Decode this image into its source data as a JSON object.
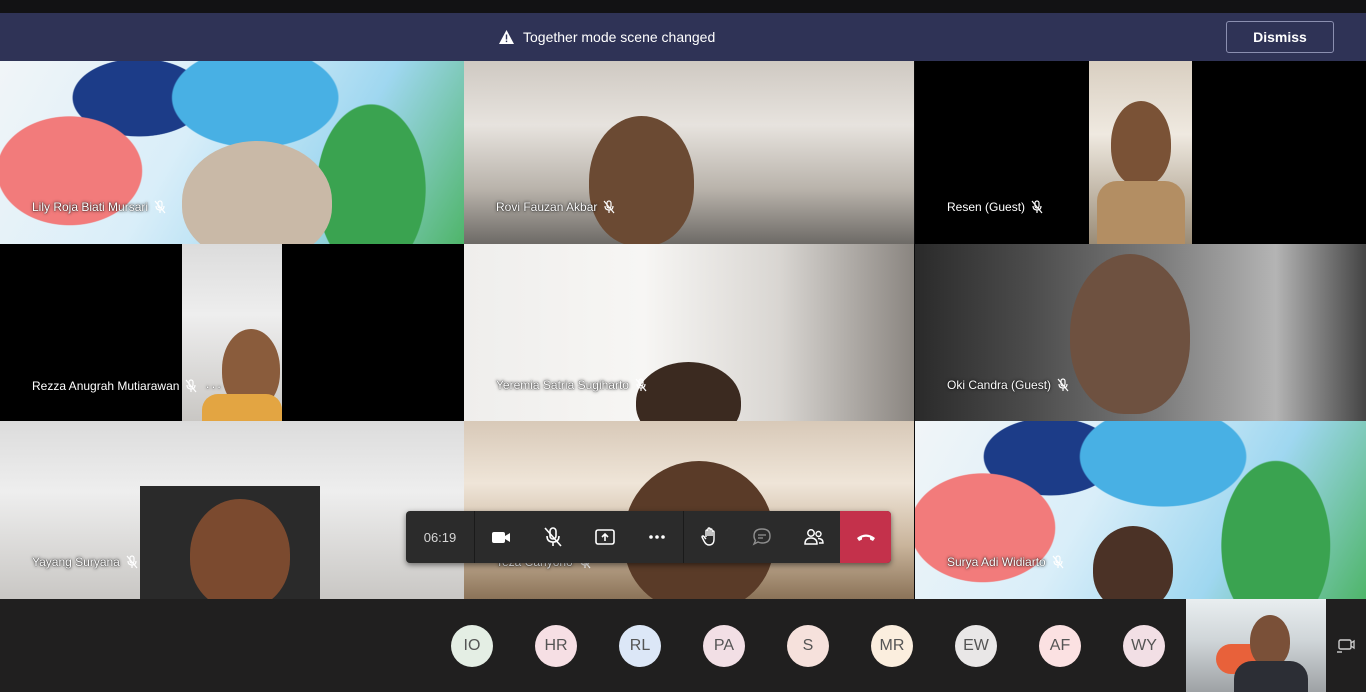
{
  "banner": {
    "message": "Together mode scene changed",
    "dismiss_label": "Dismiss"
  },
  "participants": [
    {
      "name": "Lily Roja Biati Mursari"
    },
    {
      "name": "Rovi Fauzan Akbar"
    },
    {
      "name": "Resen (Guest)"
    },
    {
      "name": "Rezza Anugrah Mutiarawan",
      "more": "···"
    },
    {
      "name": "Yeremia Satria Sugiharto"
    },
    {
      "name": "Oki Candra (Guest)"
    },
    {
      "name": "Yayang Suryana"
    },
    {
      "name": "Teza Cahyono"
    },
    {
      "name": "Surya Adi Widiarto"
    }
  ],
  "toolbar": {
    "timer": "06:19",
    "icons": [
      "camera-icon",
      "mic-off-icon",
      "share-screen-icon",
      "more-icon",
      "raise-hand-icon",
      "chat-icon",
      "participants-icon",
      "hang-up-icon"
    ]
  },
  "roster": [
    {
      "initials": "IO",
      "color": "#e4eee4"
    },
    {
      "initials": "HR",
      "color": "#f6dfe4"
    },
    {
      "initials": "RL",
      "color": "#dce7f7"
    },
    {
      "initials": "PA",
      "color": "#f2dfe5"
    },
    {
      "initials": "S",
      "color": "#f6e1dc"
    },
    {
      "initials": "MR",
      "color": "#fbeede"
    },
    {
      "initials": "EW",
      "color": "#e9e7e7"
    },
    {
      "initials": "AF",
      "color": "#fbe1e2"
    },
    {
      "initials": "WY",
      "color": "#f2dfe5"
    }
  ],
  "colors": {
    "banner_bg": "#2f3356",
    "toolbar_bg": "#2b2b2b",
    "hangup": "#c4314b"
  }
}
